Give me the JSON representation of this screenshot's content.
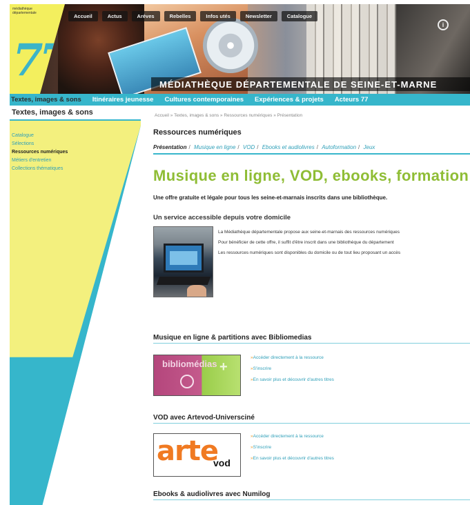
{
  "banner": {
    "title": "MÉDIATHÈQUE DÉPARTEMENTALE DE SEINE-ET-MARNE",
    "logo_number": "77",
    "logo_small_text": "médiathèque départementale",
    "top_nav": [
      "Accueil",
      "Actus",
      "Aréves",
      "Rebelles",
      "Infos utés",
      "Newsletter",
      "Catalogue"
    ]
  },
  "main_nav": [
    "Textes, images & sons",
    "Itinéraires jeunesse",
    "Cultures contemporaines",
    "Expériences & projets",
    "Acteurs 77"
  ],
  "sidebar": {
    "heading": "Textes, images & sons",
    "items": [
      {
        "label": "Catalogue",
        "active": false
      },
      {
        "label": "Sélections",
        "active": false
      },
      {
        "label": "Ressources numériques",
        "active": true
      },
      {
        "label": "Métiers d'entretien",
        "active": false
      },
      {
        "label": "Collections thématiques",
        "active": false
      }
    ]
  },
  "content": {
    "breadcrumb": "Accueil » Textes, images & sons » Ressources numériques » Présentation",
    "section_title": "Ressources numériques",
    "tabs": [
      {
        "label": "Présentation",
        "current": true
      },
      {
        "label": "Musique en ligne",
        "current": false
      },
      {
        "label": "VOD",
        "current": false
      },
      {
        "label": "Ebooks et audiolivres",
        "current": false
      },
      {
        "label": "Autoformation",
        "current": false
      },
      {
        "label": "Jeux",
        "current": false
      }
    ],
    "heading": "Musique en ligne, VOD, ebooks, formation",
    "lead": "Une offre gratuite et légale pour tous les seine-et-marnais inscrits dans une bibliothèque.",
    "subheading": "Un service accessible depuis votre domicile",
    "paragraphs": [
      "La Médiathèque départementale propose aux seine-et-marnais des ressources numériques",
      "Pour bénéficier de cette offre, il suffit d'être inscrit dans une bibliothèque du département",
      "Les ressources numériques sont disponibles du domicile ou de tout lieu proposant un accès"
    ],
    "resources": [
      {
        "title": "Musique en ligne & partitions avec Bibliomedias",
        "image_text": "bibliomédias",
        "links": [
          "Accéder directement à la ressource",
          "S'inscrire",
          "En savoir plus et découvrir d'autres titres"
        ]
      },
      {
        "title": "VOD avec Artevod-Universciné",
        "image_text": "arte",
        "image_sub": "vod",
        "links": [
          "Accéder directement à la ressource",
          "S'inscrire",
          "En savoir plus et découvrir d'autres titres"
        ]
      },
      {
        "title": "Ebooks & audiolivres avec Numilog"
      }
    ]
  },
  "colors": {
    "accent": "#36b6cb",
    "yellow": "#f3f07e",
    "green_heading": "#8fbd35",
    "link": "#2e9fb8"
  }
}
